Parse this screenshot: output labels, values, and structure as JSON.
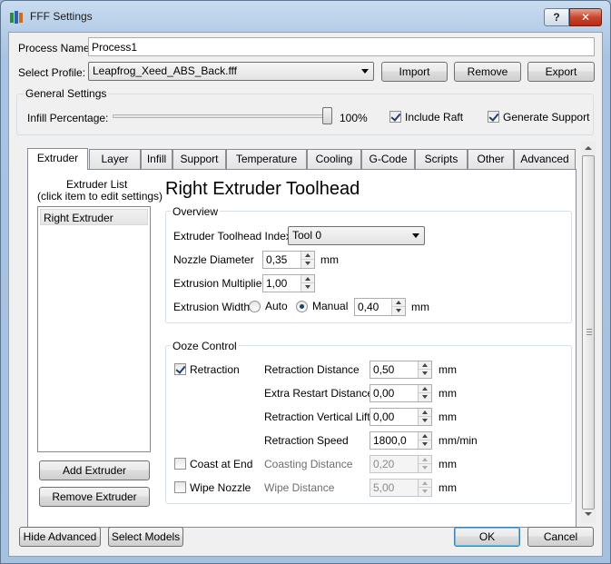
{
  "window": {
    "title": "FFF Settings",
    "help_label": "?",
    "close_label": "✕"
  },
  "process": {
    "name_label": "Process Name:",
    "name_value": "Process1",
    "profile_label": "Select Profile:",
    "profile_value": "Leapfrog_Xeed_ABS_Back.fff",
    "import_label": "Import",
    "remove_label": "Remove",
    "export_label": "Export"
  },
  "general": {
    "group_title": "General Settings",
    "infill_label": "Infill Percentage:",
    "infill_value": "100%",
    "infill_fraction": 1.0,
    "include_raft_label": "Include Raft",
    "include_raft_checked": true,
    "generate_support_label": "Generate Support",
    "generate_support_checked": true
  },
  "tabs": [
    {
      "label": "Extruder",
      "active": true
    },
    {
      "label": "Layer"
    },
    {
      "label": "Infill"
    },
    {
      "label": "Support"
    },
    {
      "label": "Temperature"
    },
    {
      "label": "Cooling"
    },
    {
      "label": "G-Code"
    },
    {
      "label": "Scripts"
    },
    {
      "label": "Other"
    },
    {
      "label": "Advanced"
    }
  ],
  "extruder": {
    "list_title_1": "Extruder List",
    "list_title_2": "(click item to edit settings)",
    "list_items": [
      "Right Extruder"
    ],
    "add_label": "Add Extruder",
    "remove_label": "Remove Extruder",
    "heading": "Right Extruder Toolhead",
    "overview": {
      "title": "Overview",
      "index_label": "Extruder Toolhead Index",
      "index_value": "Tool 0",
      "nozzle_label": "Nozzle Diameter",
      "nozzle_value": "0,35",
      "nozzle_unit": "mm",
      "multiplier_label": "Extrusion Multiplier",
      "multiplier_value": "1,00",
      "width_label": "Extrusion Width",
      "auto_label": "Auto",
      "manual_label": "Manual",
      "width_value": "0,40",
      "width_unit": "mm"
    },
    "ooze": {
      "title": "Ooze Control",
      "retraction_label": "Retraction",
      "retraction_checked": true,
      "coast_label": "Coast at End",
      "coast_checked": false,
      "wipe_label": "Wipe Nozzle",
      "wipe_checked": false,
      "rows": [
        {
          "label": "Retraction Distance",
          "value": "0,50",
          "unit": "mm"
        },
        {
          "label": "Extra Restart Distance",
          "value": "0,00",
          "unit": "mm"
        },
        {
          "label": "Retraction Vertical Lift",
          "value": "0,00",
          "unit": "mm"
        },
        {
          "label": "Retraction Speed",
          "value": "1800,0",
          "unit": "mm/min"
        },
        {
          "label": "Coasting Distance",
          "value": "0,20",
          "unit": "mm"
        },
        {
          "label": "Wipe Distance",
          "value": "5,00",
          "unit": "mm"
        }
      ]
    }
  },
  "footer": {
    "hide_advanced_label": "Hide Advanced",
    "select_models_label": "Select Models",
    "ok_label": "OK",
    "cancel_label": "Cancel"
  }
}
